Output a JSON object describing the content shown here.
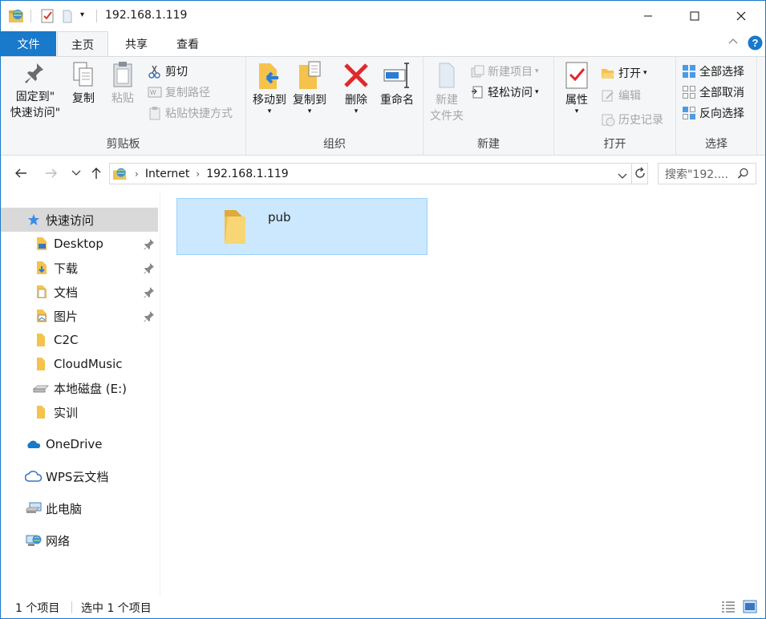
{
  "window": {
    "title": "192.168.1.119",
    "accent": "#1979ca"
  },
  "tabs": [
    {
      "label": "文件"
    },
    {
      "label": "主页"
    },
    {
      "label": "共享"
    },
    {
      "label": "查看"
    }
  ],
  "ribbon": {
    "clipboard": {
      "pin_label_1": "固定到\"",
      "pin_label_2": "快速访问\"",
      "copy": "复制",
      "paste": "粘贴",
      "cut": "剪切",
      "copy_path": "复制路径",
      "paste_shortcut": "粘贴快捷方式",
      "group": "剪贴板"
    },
    "organize": {
      "move_to": "移动到",
      "copy_to": "复制到",
      "delete": "删除",
      "rename": "重命名",
      "group": "组织"
    },
    "new": {
      "new_folder_1": "新建",
      "new_folder_2": "文件夹",
      "new_item": "新建项目",
      "easy_access": "轻松访问",
      "group": "新建"
    },
    "open": {
      "properties": "属性",
      "open": "打开",
      "edit": "编辑",
      "history": "历史记录",
      "group": "打开"
    },
    "select": {
      "select_all": "全部选择",
      "select_none": "全部取消",
      "invert": "反向选择",
      "group": "选择"
    }
  },
  "address": {
    "segments": [
      "Internet",
      "192.168.1.119"
    ],
    "search_placeholder": "搜索\"192...."
  },
  "nav": {
    "quick_access": "快速访问",
    "items": [
      {
        "label": "Desktop"
      },
      {
        "label": "下载"
      },
      {
        "label": "文档"
      },
      {
        "label": "图片"
      },
      {
        "label": "C2C"
      },
      {
        "label": "CloudMusic"
      },
      {
        "label": "本地磁盘 (E:)"
      },
      {
        "label": "实训"
      }
    ],
    "onedrive": "OneDrive",
    "wps": "WPS云文档",
    "this_pc": "此电脑",
    "network": "网络"
  },
  "content": {
    "items": [
      {
        "name": "pub"
      }
    ]
  },
  "status": {
    "count": "1 个项目",
    "selected": "选中 1 个项目"
  }
}
